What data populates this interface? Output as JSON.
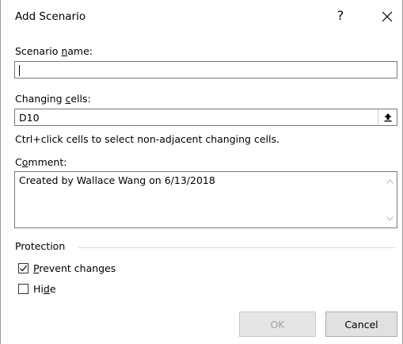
{
  "dialog": {
    "title": "Add Scenario",
    "help_glyph": "?",
    "scenario_name": {
      "label_pre": "Scenario ",
      "label_accel": "n",
      "label_post": "ame:",
      "value": ""
    },
    "changing_cells": {
      "label_pre": "Changing ",
      "label_accel": "c",
      "label_post": "ells:",
      "value": "D10"
    },
    "hint": "Ctrl+click cells to select non-adjacent changing cells.",
    "comment": {
      "label_pre": "C",
      "label_accel": "o",
      "label_post": "mment:",
      "value": "Created by Wallace Wang on 6/13/2018"
    },
    "protection": {
      "title": "Protection",
      "prevent_changes": {
        "label_pre": "",
        "label_accel": "P",
        "label_post": "revent changes",
        "checked": true
      },
      "hide": {
        "label_pre": "Hi",
        "label_accel": "d",
        "label_post": "e",
        "checked": false
      }
    },
    "buttons": {
      "ok": "OK",
      "cancel": "Cancel"
    }
  },
  "icons": {
    "close": "close-icon",
    "collapse": "collapse-dialog-icon",
    "scroll_up": "chevron-up-icon",
    "scroll_down": "chevron-down-icon",
    "check": "checkmark-icon"
  }
}
